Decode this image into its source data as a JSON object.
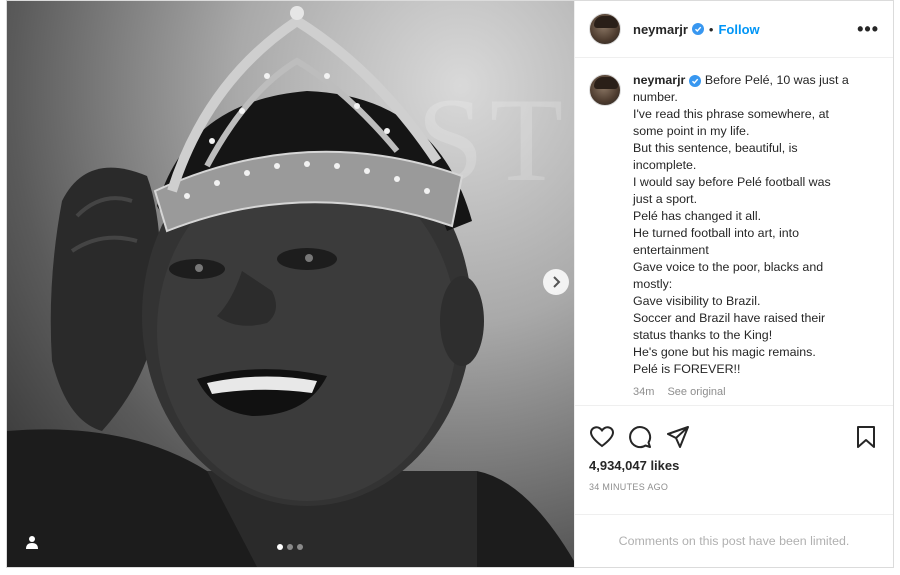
{
  "post": {
    "username": "neymarjr",
    "follow_label": "Follow",
    "more_label": "•••",
    "separator": "•",
    "caption_first": "Before Pelé, 10 was just a",
    "caption_lines": [
      "number.",
      "I've read this phrase somewhere, at",
      "some point in my life.",
      "But this sentence, beautiful, is",
      "incomplete.",
      "I would say before Pelé football was",
      "just a sport.",
      "Pelé has changed it all.",
      "He turned football into art, into",
      "entertainment",
      "Gave voice to the poor, blacks and",
      "mostly:",
      "Gave visibility to Brazil.",
      "Soccer and Brazil have raised their",
      "status thanks to the King!",
      "He's gone but his magic remains.",
      "Pelé is FOREVER!!"
    ],
    "age": "34m",
    "see_original": "See original",
    "likes": "4,934,047 likes",
    "timestamp": "34 MINUTES AGO",
    "comments_limited": "Comments on this post have been limited."
  },
  "media": {
    "background_word": "ST",
    "carousel_count": 3,
    "carousel_active": 0
  },
  "icons": {
    "verified": "verified-badge-icon",
    "next": "chevron-right-icon",
    "tag": "user-tag-icon",
    "like": "heart-icon",
    "comment": "comment-icon",
    "share": "paper-plane-icon",
    "save": "bookmark-icon"
  },
  "colors": {
    "accent": "#0095f6",
    "verified": "#3897f0",
    "text": "#262626",
    "muted": "#8e8e8e"
  }
}
